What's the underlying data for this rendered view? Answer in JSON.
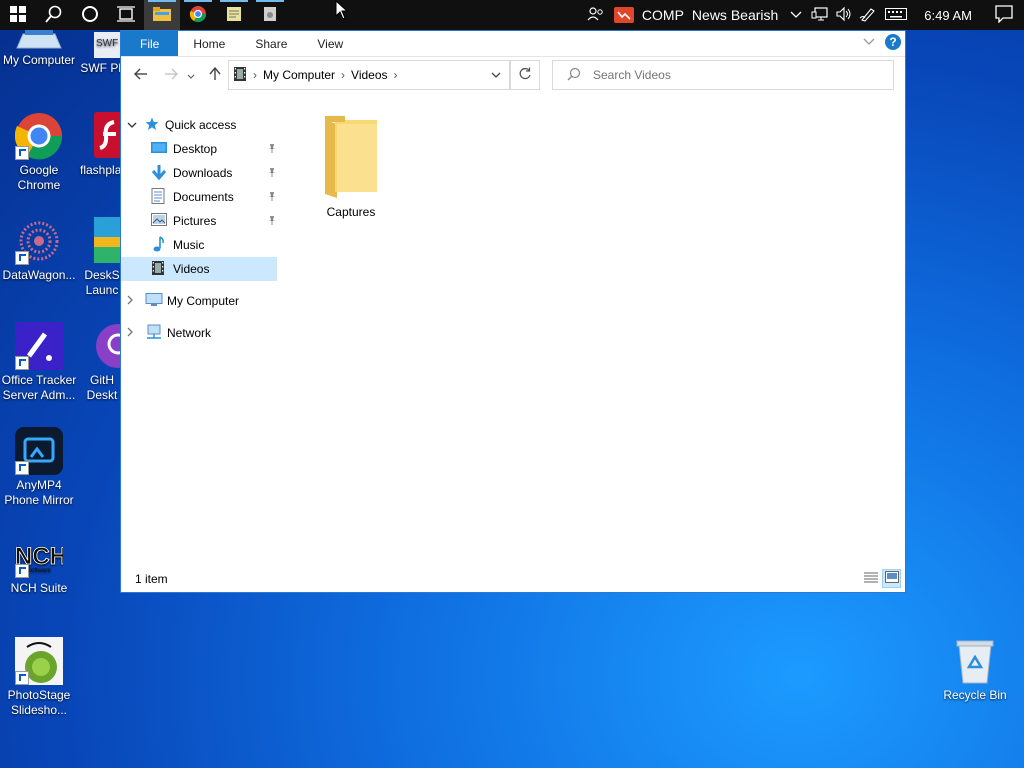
{
  "taskbar": {
    "ticker_symbol": "COMP",
    "ticker_text": "News Bearish",
    "clock": "6:49 AM"
  },
  "desktop": {
    "icons": [
      {
        "label": "My Computer"
      },
      {
        "label": "SWF Play"
      },
      {
        "label": "Google Chrome"
      },
      {
        "label": "flashpla"
      },
      {
        "label": "DataWagon..."
      },
      {
        "label": "DeskS Launc"
      },
      {
        "label": "Office Tracker Server Adm..."
      },
      {
        "label": "GitH Deskt"
      },
      {
        "label": "AnyMP4 Phone Mirror"
      },
      {
        "label": "NCH Suite"
      },
      {
        "label": "PhotoStage Slidesho..."
      },
      {
        "label": "Recycle Bin"
      }
    ]
  },
  "explorer": {
    "tabs": {
      "file": "File",
      "home": "Home",
      "share": "Share",
      "view": "View"
    },
    "help_glyph": "?",
    "breadcrumb": {
      "root": "My Computer",
      "current": "Videos"
    },
    "search_placeholder": "Search Videos",
    "nav": {
      "quick_access": "Quick access",
      "desktop": "Desktop",
      "downloads": "Downloads",
      "documents": "Documents",
      "pictures": "Pictures",
      "music": "Music",
      "videos": "Videos",
      "my_computer": "My Computer",
      "network": "Network"
    },
    "items": [
      {
        "name": "Captures"
      }
    ],
    "status": "1 item"
  },
  "colors": {
    "accent": "#1979ca",
    "selection": "#cce8ff",
    "taskbar": "#101010",
    "folder": "#f8d775"
  }
}
